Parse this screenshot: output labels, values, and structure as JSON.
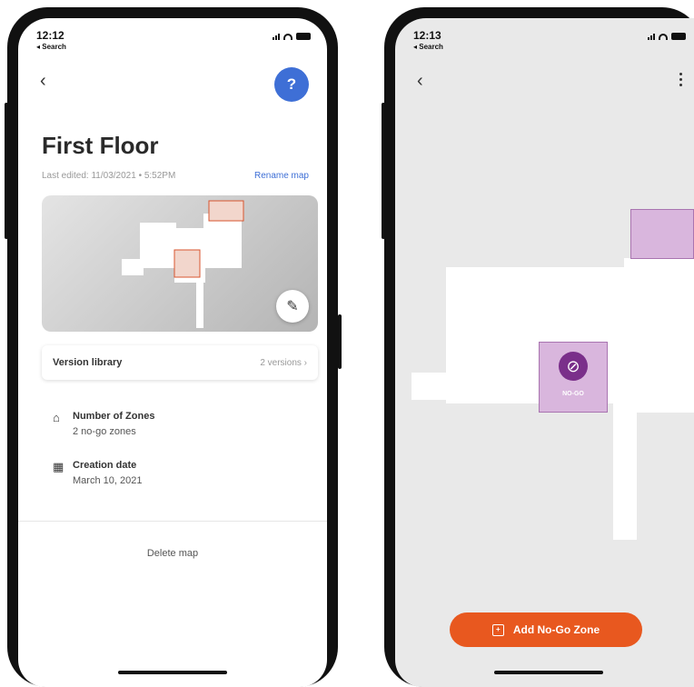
{
  "left_screen": {
    "status": {
      "time": "12:12",
      "back_app": "◂ Search"
    },
    "title": "First Floor",
    "last_edited": "Last edited: 11/03/2021 • 5:52PM",
    "rename_link": "Rename map",
    "help_label": "?",
    "version_library": {
      "label": "Version library",
      "count": "2 versions"
    },
    "info": [
      {
        "title": "Number of Zones",
        "value": "2 no-go zones",
        "icon": "home-icon"
      },
      {
        "title": "Creation date",
        "value": "March 10, 2021",
        "icon": "map-icon"
      }
    ],
    "delete_label": "Delete map"
  },
  "right_screen": {
    "status": {
      "time": "12:13",
      "back_app": "◂ Search"
    },
    "nogo_label": "NO-GO",
    "add_button_label": "Add No-Go Zone"
  },
  "colors": {
    "accent_blue": "#3e6fd6",
    "accent_orange": "#e8581f",
    "nogo_fill": "#d9b6dd",
    "nogo_icon": "#7a2f8a"
  }
}
